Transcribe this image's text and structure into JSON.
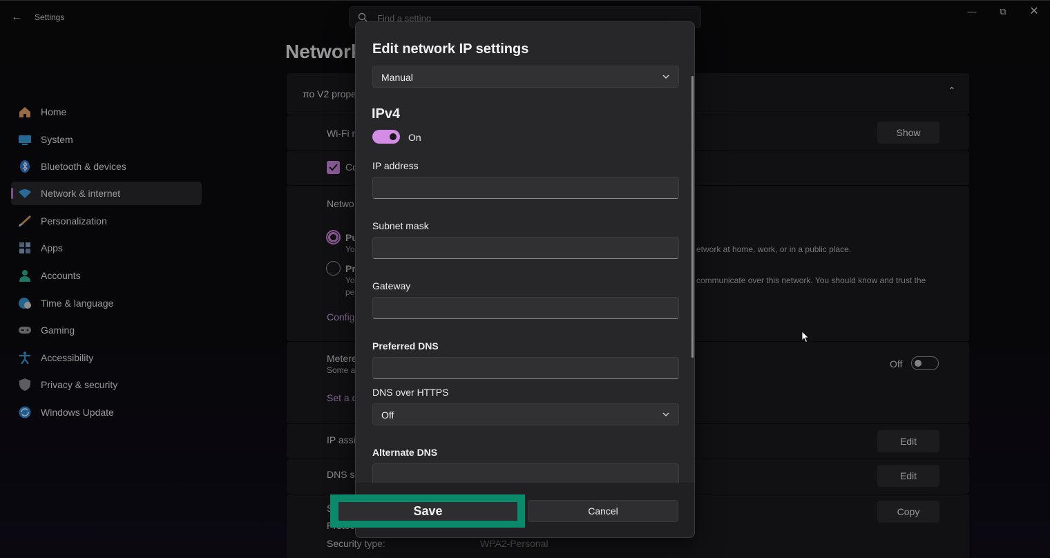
{
  "window": {
    "app_title": "Settings",
    "search_placeholder": "Find a setting"
  },
  "sidebar": {
    "items": [
      {
        "label": "Home",
        "icon": "home-icon",
        "color": "#e9a36b"
      },
      {
        "label": "System",
        "icon": "system-icon",
        "color": "#3aa0e0"
      },
      {
        "label": "Bluetooth & devices",
        "icon": "bluetooth-icon",
        "color": "#2f7ad9"
      },
      {
        "label": "Network & internet",
        "icon": "wifi-icon",
        "color": "#3fa4e8",
        "active": true
      },
      {
        "label": "Personalization",
        "icon": "brush-icon",
        "color": "#e0a060"
      },
      {
        "label": "Apps",
        "icon": "apps-icon",
        "color": "#6f8db0"
      },
      {
        "label": "Accounts",
        "icon": "accounts-icon",
        "color": "#2fb59a"
      },
      {
        "label": "Time & language",
        "icon": "globe-clock-icon",
        "color": "#3a9ad8"
      },
      {
        "label": "Gaming",
        "icon": "gamepad-icon",
        "color": "#9a9a9a"
      },
      {
        "label": "Accessibility",
        "icon": "accessibility-icon",
        "color": "#3a9de0"
      },
      {
        "label": "Privacy & security",
        "icon": "shield-icon",
        "color": "#8f8f96"
      },
      {
        "label": "Windows Update",
        "icon": "update-icon",
        "color": "#2f8fe0"
      }
    ]
  },
  "background": {
    "page_title": "Network",
    "card_header": "πο V2 prope",
    "wifi_row": "Wi-Fi n",
    "show_btn": "Show",
    "connect_row": "Co",
    "network_profile": "Netwo",
    "public_label": "Pu",
    "public_desc_1": "Yo",
    "public_desc_2": "etwork at home, work, or in a public place.",
    "private_label": "Pr",
    "private_desc_1": "Yo",
    "private_desc_2": "pe",
    "private_desc_3": "communicate over this network. You should know and trust the",
    "config_link": "Config",
    "metered_label": "Metere",
    "metered_desc": "Some ap",
    "metered_state": "Off",
    "data_limit_link": "Set a d",
    "ip_assign_label": "IP assig",
    "edit_btn_1": "Edit",
    "dns_label": "DNS se",
    "edit_btn_2": "Edit",
    "ssid_label": "S",
    "protocol_label": "Protoc",
    "copy_btn": "Copy",
    "security_label": "Security type:",
    "security_value": "WPA2-Personal"
  },
  "dialog": {
    "title": "Edit network IP settings",
    "mode_value": "Manual",
    "section": "IPv4",
    "toggle_state": "On",
    "ip_label": "IP address",
    "subnet_label": "Subnet mask",
    "gateway_label": "Gateway",
    "pref_dns_label": "Preferred DNS",
    "doh_label": "DNS over HTTPS",
    "doh_value": "Off",
    "alt_dns_label": "Alternate DNS",
    "save_label": "Save",
    "cancel_label": "Cancel",
    "highlight_color": "#0a8a6a",
    "accent_color": "#d58ce6"
  }
}
